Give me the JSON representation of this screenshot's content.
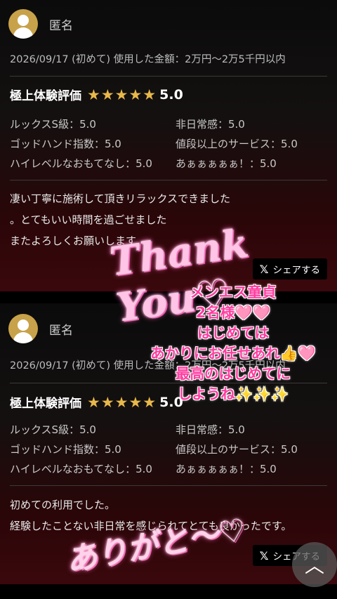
{
  "reviews": [
    {
      "author": "匿名",
      "meta": "2026/09/17 (初めて) 使用した金額：2万円〜2万5千円以内",
      "rating_title": "極上体験評価",
      "stars": "★★★★★",
      "score": "5.0",
      "criteria": [
        "ルックスS級：5.0",
        "非日常感：5.0",
        "ゴッドハンド指数：5.0",
        "値段以上のサービス：5.0",
        "ハイレベルなおもてなし：5.0",
        "あぁぁぁぁぁ！：5.0"
      ],
      "comment": "凄い丁寧に施術して頂きリラックスできました\n。とてもいい時間を過ごせました\nまたよろしくお願いします",
      "share_label": "シェアする"
    },
    {
      "author": "匿名",
      "meta": "2026/09/17 (初めて) 使用した金額：2万円〜2万5千円以内",
      "rating_title": "極上体験評価",
      "stars": "★★★★★",
      "score": "5.0",
      "criteria": [
        "ルックスS級：5.0",
        "非日常感：5.0",
        "ゴッドハンド指数：5.0",
        "値段以上のサービス：5.0",
        "ハイレベルなおもてなし：5.0",
        "あぁぁぁぁぁ！：5.0"
      ],
      "comment": "初めての利用でした。\n経験したことない非日常を感じられてとても良かったです。",
      "share_label": "シェアする"
    }
  ],
  "share_icon": "x-logo-icon",
  "overlays": {
    "thank_you": "Thank You♡",
    "message": "メンエス童貞\n2名様🩷🩷\nはじめては\nあかりにお任せあれ👍🩷\n最高のはじめてに\nしようね✨✨✨",
    "arigato": "ありがと〜♡"
  },
  "scroll_top_icon": "chevron-up-icon",
  "colors": {
    "star": "#e8b84a",
    "avatar": "#c8a24a",
    "overlay_pink": "#ff3da0"
  }
}
